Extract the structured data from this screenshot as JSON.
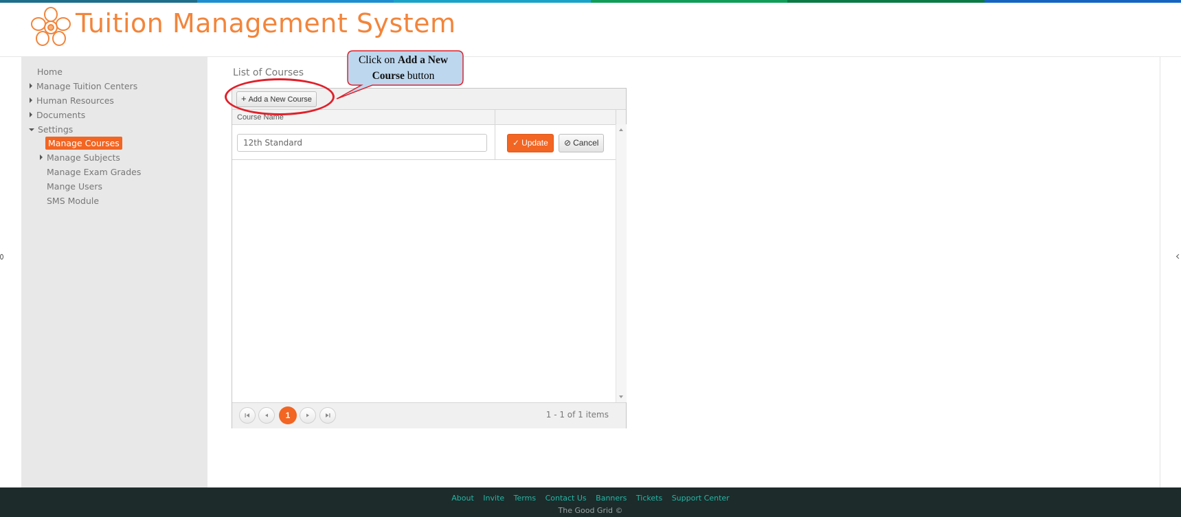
{
  "colors": {
    "brand": "#f2853b",
    "accent": "#f26522",
    "footer_bg": "#1d2b2b",
    "footer_link": "#23b8a6",
    "callout_border": "#e0202a",
    "callout_fill": "#bdd7ee"
  },
  "header": {
    "title": "Tuition Management System",
    "logo_icon": "flower-logo-icon"
  },
  "sidebar": {
    "items": [
      {
        "label": "Home"
      },
      {
        "label": "Manage Tuition Centers"
      },
      {
        "label": "Human Resources"
      },
      {
        "label": "Documents"
      },
      {
        "label": "Settings"
      },
      {
        "label": "Manage Courses"
      },
      {
        "label": "Manage Subjects"
      },
      {
        "label": "Manage Exam Grades"
      },
      {
        "label": "Mange Users"
      },
      {
        "label": "SMS Module"
      }
    ]
  },
  "main": {
    "title": "List of Courses",
    "toolbar": {
      "add_label": "Add a New Course"
    },
    "columns": [
      "Course Name",
      ""
    ],
    "edit_row": {
      "course_value": "12th Standard",
      "update_label": "Update",
      "cancel_label": "Cancel"
    },
    "pager": {
      "current_page": "1",
      "info": "1 - 1 of 1 items"
    }
  },
  "callout": {
    "prefix": "Click on ",
    "bold": "Add a New Course",
    "suffix": " button"
  },
  "footer": {
    "links": [
      "About",
      "Invite",
      "Terms",
      "Contact Us",
      "Banners",
      "Tickets",
      "Support Center"
    ],
    "copyright": "The Good Grid ©"
  }
}
